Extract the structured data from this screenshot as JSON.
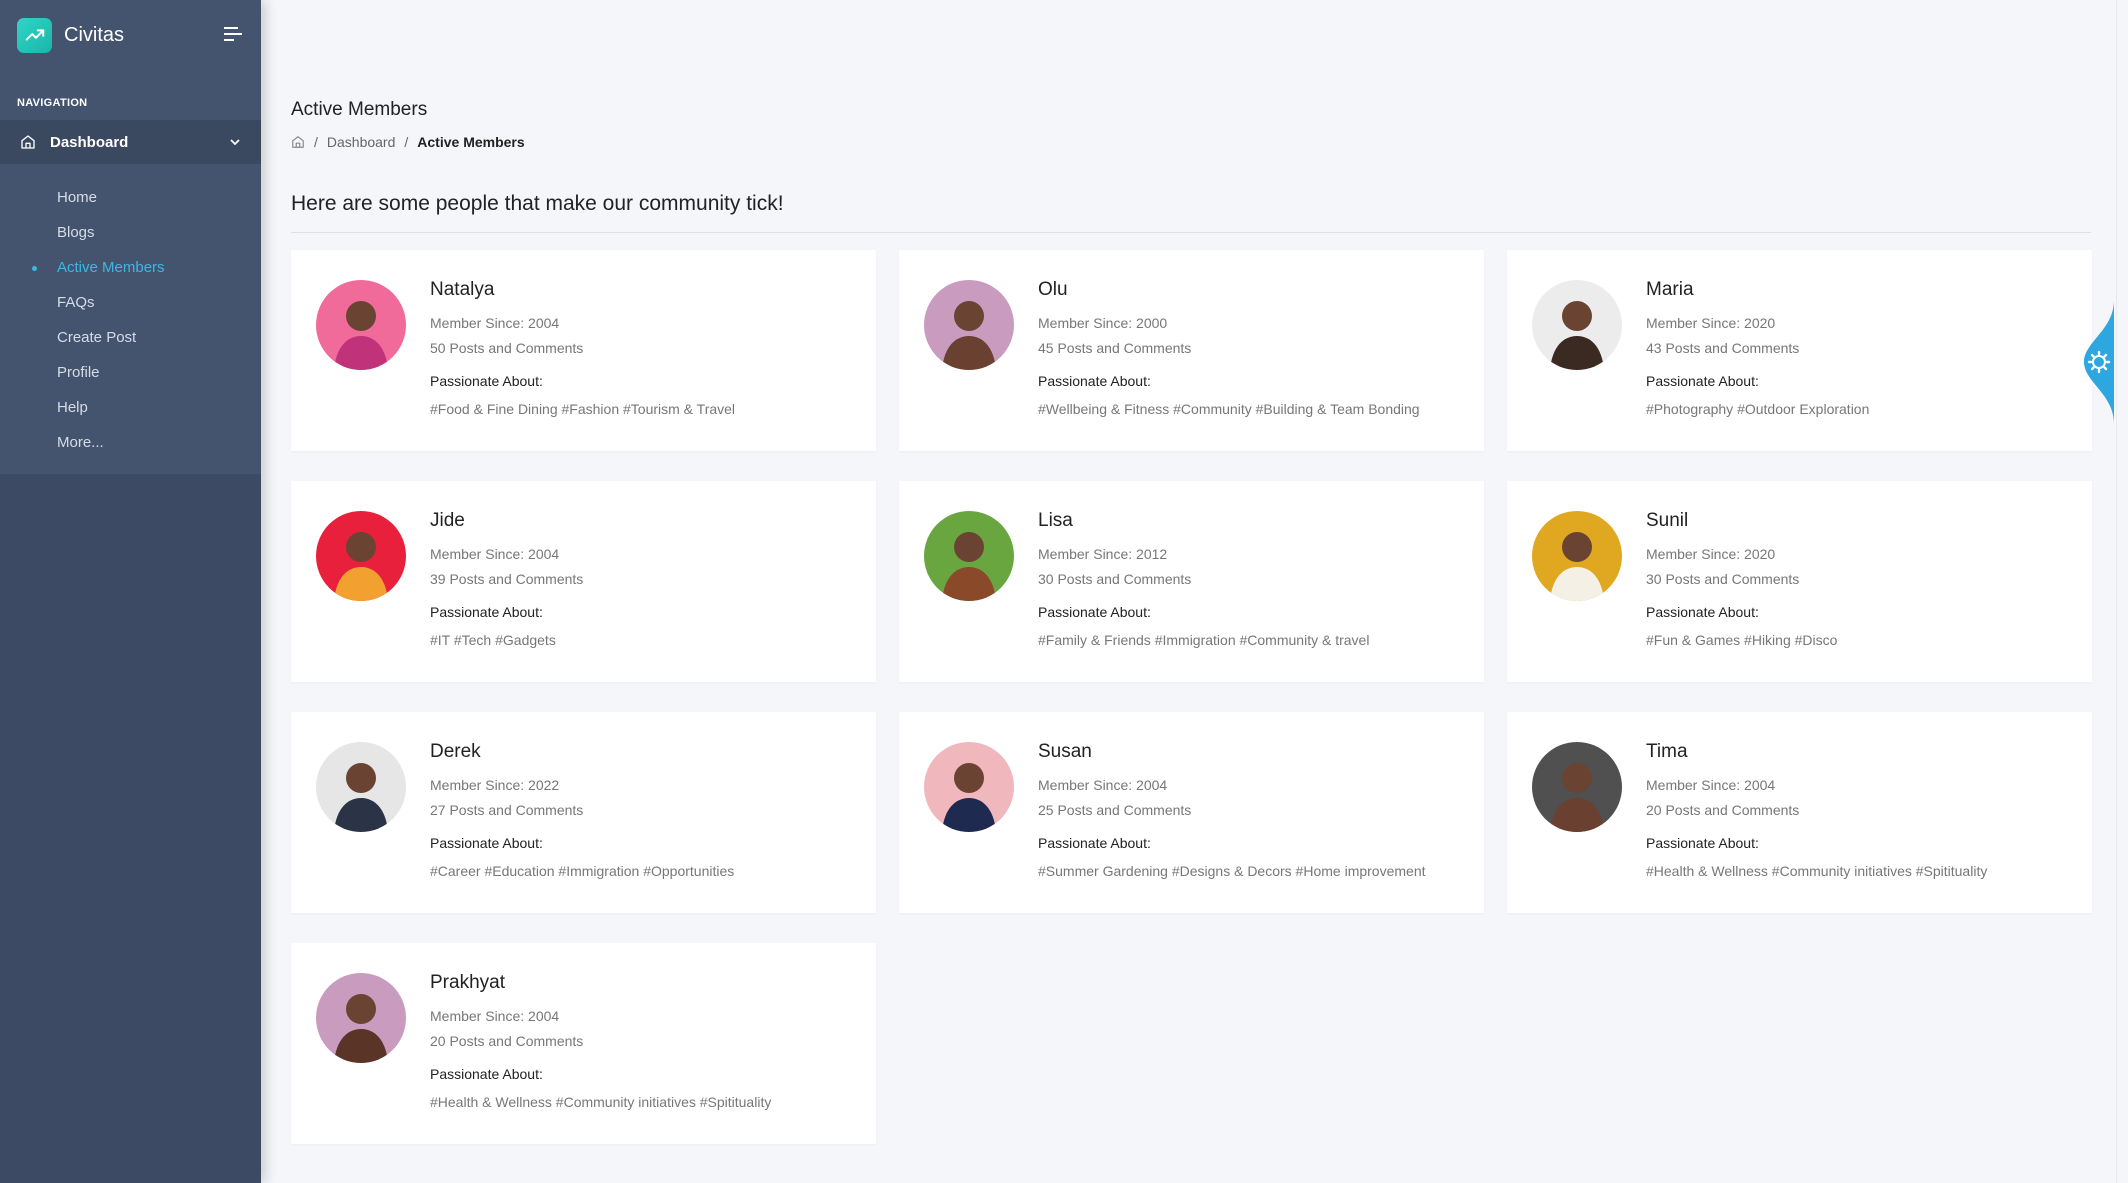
{
  "brand": {
    "name": "Civitas"
  },
  "sidebar": {
    "caption": "NAVIGATION",
    "parent_label": "Dashboard",
    "items": [
      {
        "label": "Home"
      },
      {
        "label": "Blogs"
      },
      {
        "label": "Active Members",
        "active": true
      },
      {
        "label": "FAQs"
      },
      {
        "label": "Create Post"
      },
      {
        "label": "Profile"
      },
      {
        "label": "Help"
      },
      {
        "label": "More..."
      }
    ]
  },
  "header": {
    "title": "Active Members",
    "breadcrumb": {
      "home_icon": "home-icon",
      "level1": "Dashboard",
      "current": "Active Members"
    }
  },
  "intro": "Here are some people that make our community tick!",
  "passionate_label": "Passionate About:",
  "members": [
    {
      "name": "Natalya",
      "since": "Member Since: 2004",
      "posts": "50 Posts and Comments",
      "tags": "#Food & Fine Dining #Fashion #Tourism & Travel",
      "avatar_bg": "#f06a9a",
      "avatar_fg": "#c0337a"
    },
    {
      "name": "Olu",
      "since": "Member Since: 2000",
      "posts": "45 Posts and Comments",
      "tags": "#Wellbeing & Fitness #Community #Building & Team Bonding",
      "avatar_bg": "#c99bbf",
      "avatar_fg": "#6a4030"
    },
    {
      "name": "Maria",
      "since": "Member Since: 2020",
      "posts": "43 Posts and Comments",
      "tags": "#Photography #Outdoor Exploration",
      "avatar_bg": "#ececec",
      "avatar_fg": "#3a2a22"
    },
    {
      "name": "Jide",
      "since": "Member Since: 2004",
      "posts": "39 Posts and Comments",
      "tags": "#IT #Tech #Gadgets",
      "avatar_bg": "#e8203c",
      "avatar_fg": "#f2a030"
    },
    {
      "name": "Lisa",
      "since": "Member Since: 2012",
      "posts": "30 Posts and Comments",
      "tags": "#Family & Friends #Immigration #Community & travel",
      "avatar_bg": "#6aa640",
      "avatar_fg": "#8a4a2a"
    },
    {
      "name": "Sunil",
      "since": "Member Since: 2020",
      "posts": "30 Posts and Comments",
      "tags": "#Fun & Games #Hiking #Disco",
      "avatar_bg": "#e0a820",
      "avatar_fg": "#f5f0e6"
    },
    {
      "name": "Derek",
      "since": "Member Since: 2022",
      "posts": "27 Posts and Comments",
      "tags": "#Career #Education #Immigration #Opportunities",
      "avatar_bg": "#e6e6e6",
      "avatar_fg": "#2a3446"
    },
    {
      "name": "Susan",
      "since": "Member Since: 2004",
      "posts": "25 Posts and Comments",
      "tags": "#Summer Gardening #Designs & Decors #Home improvement",
      "avatar_bg": "#f0b8bc",
      "avatar_fg": "#1e2a50"
    },
    {
      "name": "Tima",
      "since": "Member Since: 2004",
      "posts": "20 Posts and Comments",
      "tags": "#Health & Wellness #Community initiatives #Spitituality",
      "avatar_bg": "#505050",
      "avatar_fg": "#6a4030"
    },
    {
      "name": "Prakhyat",
      "since": "Member Since: 2004",
      "posts": "20 Posts and Comments",
      "tags": "#Health & Wellness #Community initiatives #Spitituality",
      "avatar_bg": "#c99bbf",
      "avatar_fg": "#5a3426"
    }
  ],
  "colors": {
    "accent": "#3fb6e6",
    "sidebar": "#3c4a63",
    "brand": "#1bb5a8"
  }
}
